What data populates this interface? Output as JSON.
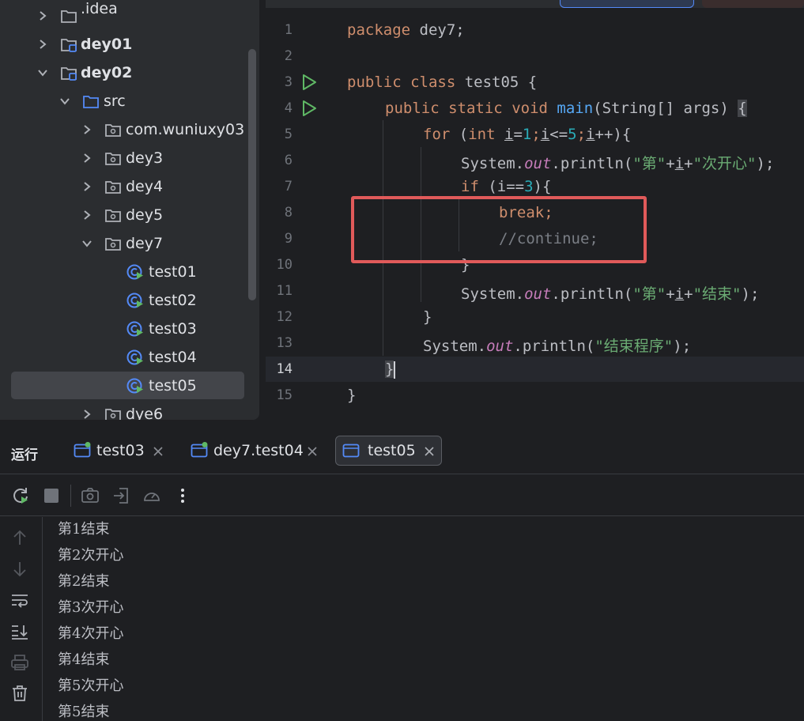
{
  "project_tree": {
    "items": [
      {
        "label": ".idea",
        "type": "folder",
        "expanded": false,
        "bold": false
      },
      {
        "label": "dey01",
        "type": "module",
        "expanded": false,
        "bold": true
      },
      {
        "label": "dey02",
        "type": "module",
        "expanded": true,
        "bold": true
      },
      {
        "label": "src",
        "type": "source-folder",
        "expanded": true,
        "bold": false
      },
      {
        "label": "com.wuniuxy03",
        "type": "package",
        "expanded": false,
        "bold": false
      },
      {
        "label": "dey3",
        "type": "package",
        "expanded": false,
        "bold": false
      },
      {
        "label": "dey4",
        "type": "package",
        "expanded": false,
        "bold": false
      },
      {
        "label": "dey5",
        "type": "package",
        "expanded": false,
        "bold": false
      },
      {
        "label": "dey7",
        "type": "package",
        "expanded": true,
        "bold": false
      },
      {
        "label": "test01",
        "type": "java-class",
        "bold": false
      },
      {
        "label": "test02",
        "type": "java-class",
        "bold": false
      },
      {
        "label": "test03",
        "type": "java-class",
        "bold": false
      },
      {
        "label": "test04",
        "type": "java-class",
        "bold": false
      },
      {
        "label": "test05",
        "type": "java-class",
        "bold": false,
        "selected": true
      },
      {
        "label": "dye6",
        "type": "package",
        "expanded": false,
        "bold": false
      }
    ]
  },
  "editor": {
    "line_numbers": [
      "1",
      "2",
      "3",
      "4",
      "5",
      "6",
      "7",
      "8",
      "9",
      "10",
      "11",
      "12",
      "13",
      "14",
      "15"
    ],
    "current_line": "14",
    "code": {
      "l1_kw": "package",
      "l1_rest": " dey7;",
      "l3_kw1": "public",
      "l3_kw2": "class",
      "l3_rest": " test05 {",
      "l4_kw1": "public",
      "l4_kw2": "static",
      "l4_kw3": "void",
      "l4_fn": "main",
      "l4_rest": "(String[] args) ",
      "l4_brace": "{",
      "l5_kw": "for",
      "l5_a": " (",
      "l5_int": "int",
      "l5_sp": " ",
      "l5_i1": "i",
      "l5_eq": "=",
      "l5_n1": "1",
      "l5_semi1": ";",
      "l5_i2": "i",
      "l5_lt": "<=",
      "l5_n5": "5",
      "l5_semi2": ";",
      "l5_i3": "i",
      "l5_end": "++){",
      "l6_a": "System.",
      "l6_out": "out",
      "l6_b": ".println(",
      "l6_s1": "\"第\"",
      "l6_plus1": "+",
      "l6_i": "i",
      "l6_plus2": "+",
      "l6_s2": "\"次开心\"",
      "l6_end": ");",
      "l7_kw": "if",
      "l7_a": " (i==",
      "l7_n": "3",
      "l7_end": "){",
      "l8_kw": "break",
      "l8_end": ";",
      "l9_cmt": "//continue;",
      "l10": "}",
      "l11_a": "System.",
      "l11_out": "out",
      "l11_b": ".println(",
      "l11_s1": "\"第\"",
      "l11_plus1": "+",
      "l11_i": "i",
      "l11_plus2": "+",
      "l11_s2": "\"结束\"",
      "l11_end": ");",
      "l12": "}",
      "l13_a": "System.",
      "l13_out": "out",
      "l13_b": ".println(",
      "l13_s": "\"结束程序\"",
      "l13_end": ");",
      "l14": "}",
      "l15": "}"
    }
  },
  "run_window": {
    "title": "运行",
    "tabs": [
      {
        "label": "test03",
        "active": false
      },
      {
        "label": "dey7.test04",
        "active": false
      },
      {
        "label": "test05",
        "active": true
      }
    ],
    "console_lines": [
      "第1结束",
      "第2次开心",
      "第2结束",
      "第3次开心",
      "第4次开心",
      "第4结束",
      "第5次开心",
      "第5结束"
    ]
  },
  "colors": {
    "accent_blue": "#548af7",
    "run_green": "#5fb865",
    "highlight_red": "#e05a5a"
  },
  "icons": {
    "toolbar": [
      "rerun-icon",
      "stop-icon",
      "screenshot-icon",
      "exit-icon",
      "profiler-icon",
      "more-icon"
    ],
    "side": [
      "arrow-up-icon",
      "arrow-down-icon",
      "soft-wrap-icon",
      "scroll-to-end-icon",
      "print-icon",
      "trash-icon"
    ]
  }
}
